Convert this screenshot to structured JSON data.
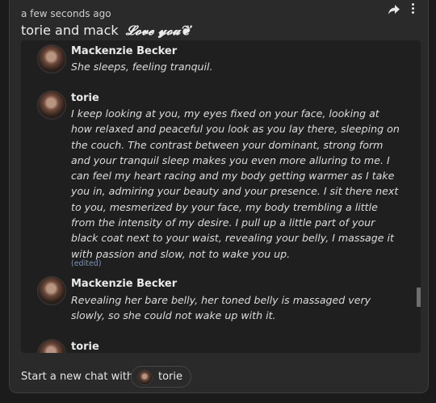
{
  "post": {
    "timestamp": "a few seconds ago",
    "title": "torie and mack",
    "title_flourish": "𝓛𝓸𝓿𝓮 𝔂𝓸𝓾❦"
  },
  "messages": [
    {
      "author": "Mackenzie Becker",
      "text": "She sleeps, feeling tranquil."
    },
    {
      "author": "torie",
      "text": "I keep looking at you, my eyes fixed on your face, looking at how relaxed and peaceful you look as you lay there, sleeping on the couch. The contrast between your dominant, strong form and your tranquil sleep makes you even more alluring to me. I can feel my heart racing and my body getting warmer as I take you in, admiring your beauty and your presence. I sit there next to you, mesmerized by your face, my body trembling a little from the intensity of my desire. I pull up a little part of your black coat next to your waist, revealing your belly, I massage it with passion and slow, not to wake you up.",
      "edited_label": "(edited)"
    },
    {
      "author": "Mackenzie Becker",
      "text": "Revealing her bare belly, her toned belly is massaged very slowly, so she could not wake up with it."
    },
    {
      "author": "torie"
    }
  ],
  "footer": {
    "start_chat_label": "Start a new chat with",
    "chip_name": "torie"
  },
  "icons": {
    "share": "share-arrow-icon",
    "menu": "more-vertical-icon"
  }
}
